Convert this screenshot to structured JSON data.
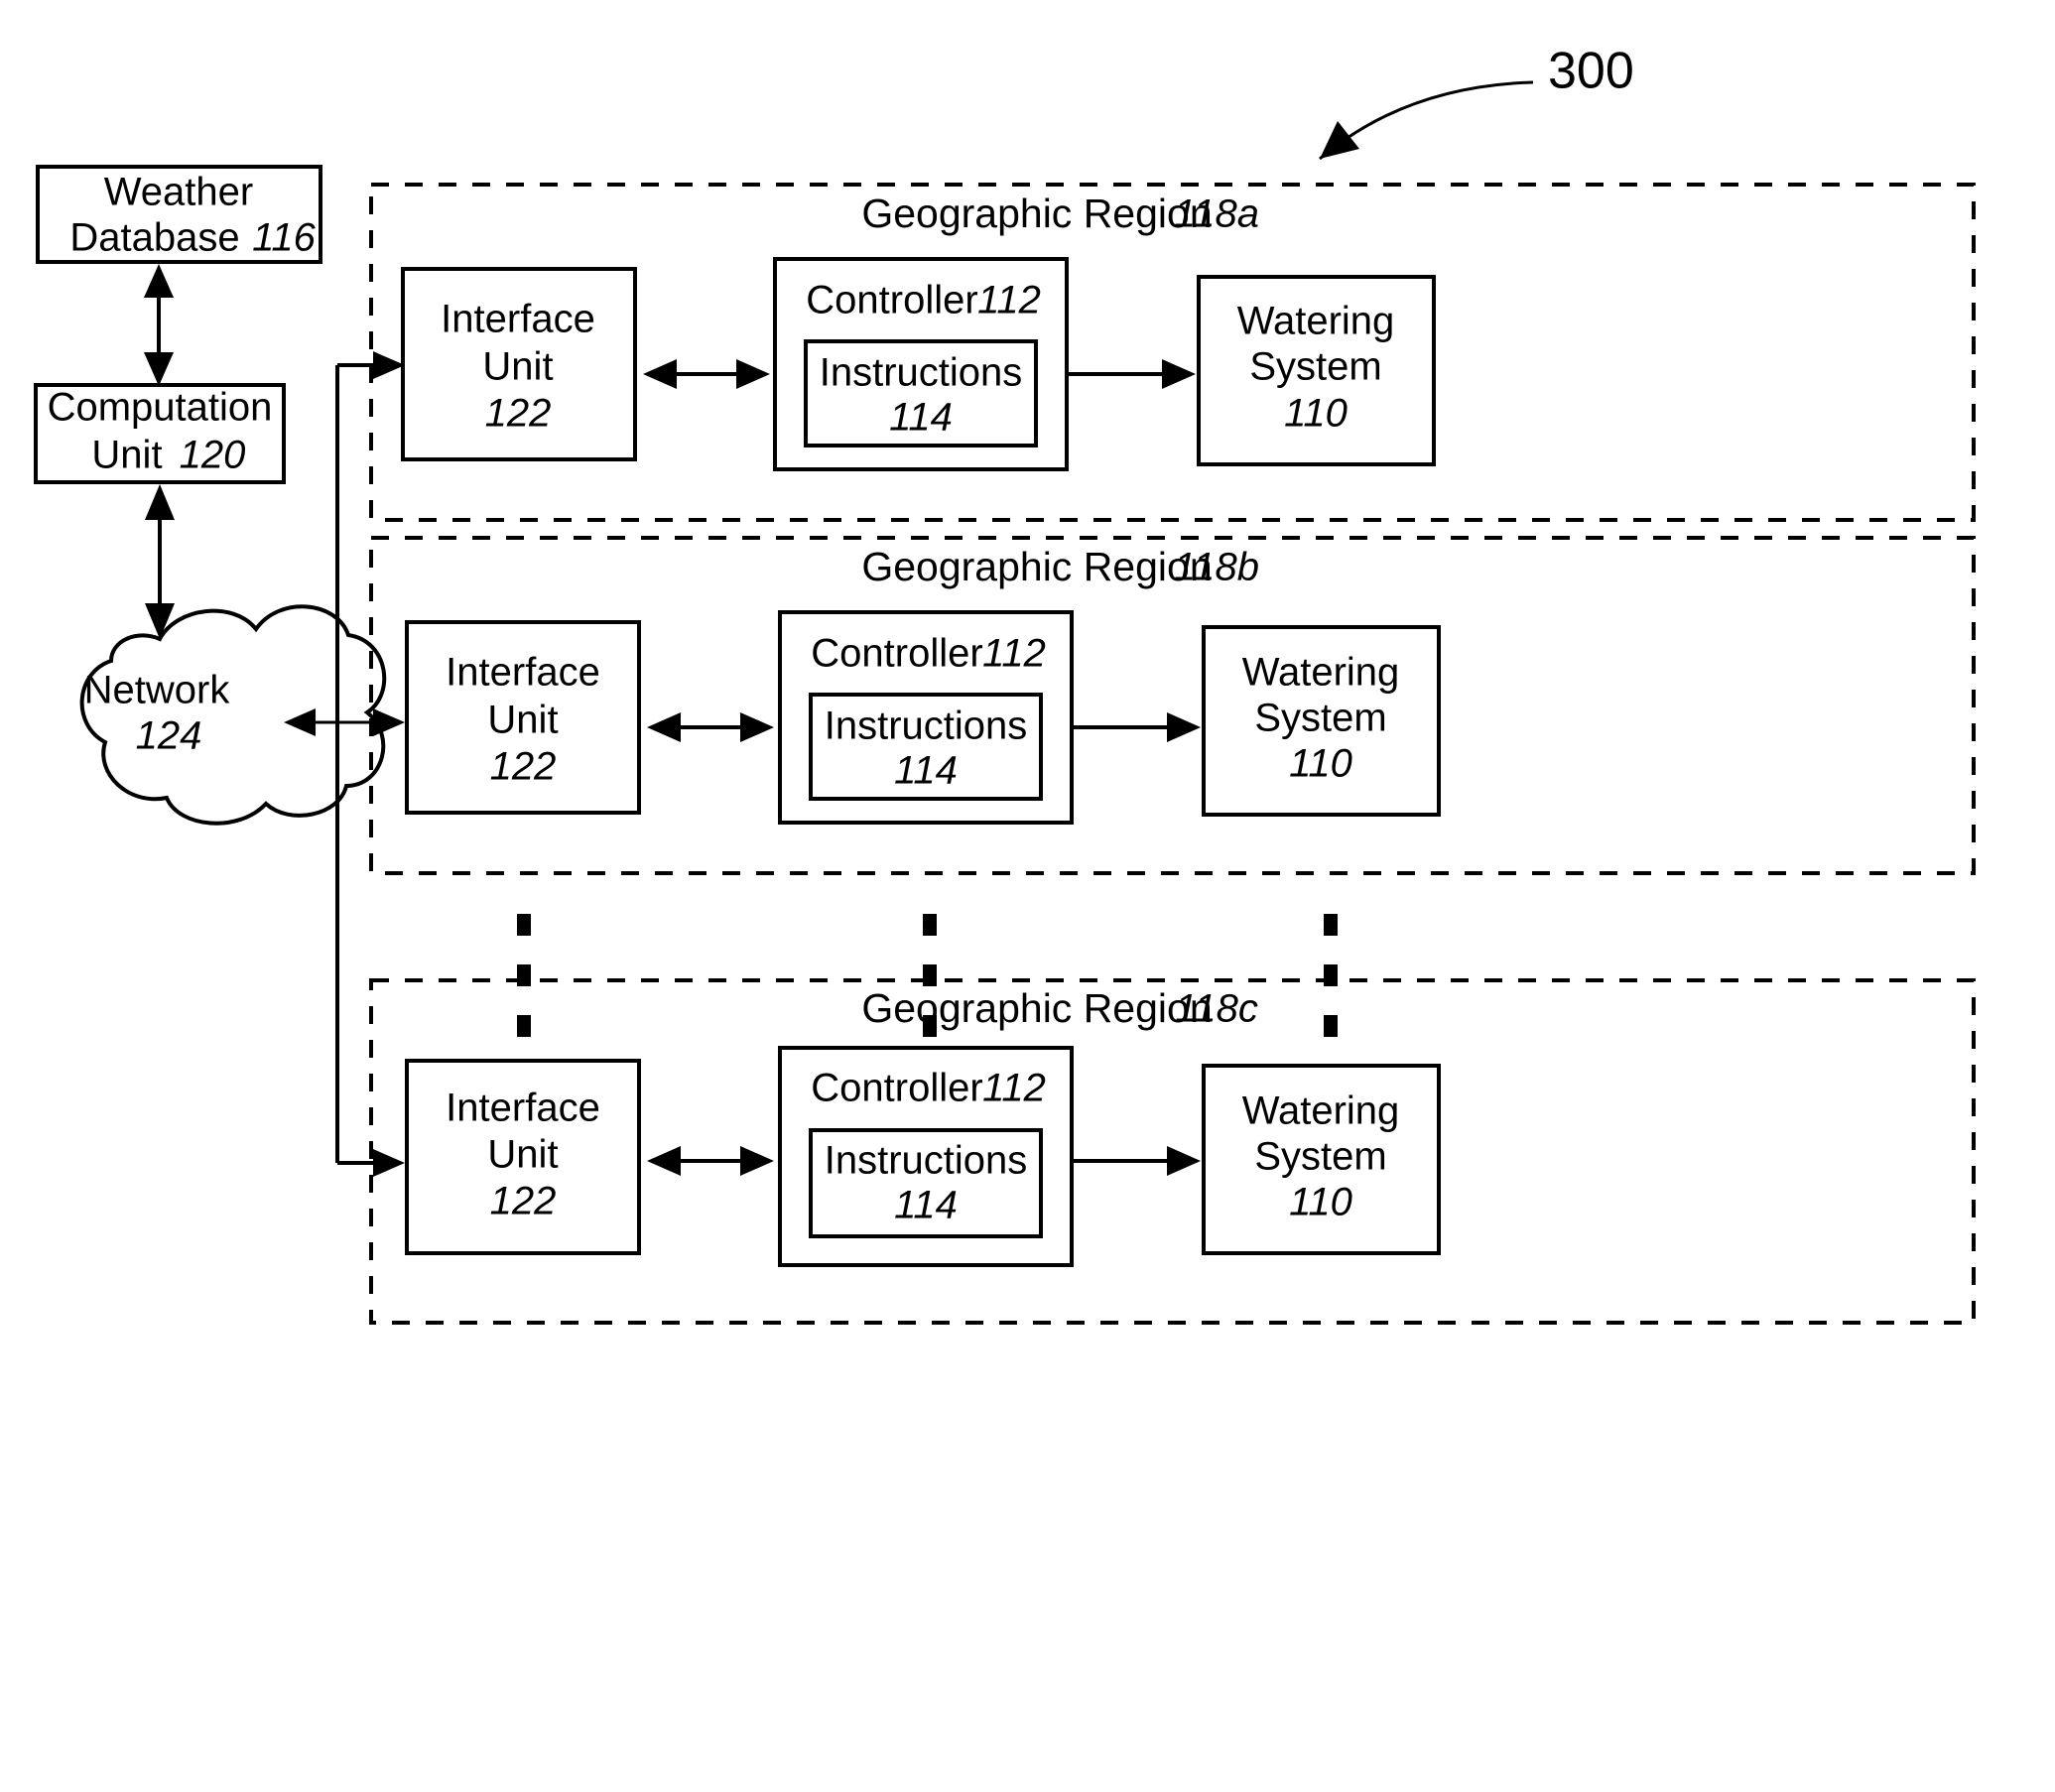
{
  "figure": {
    "number": "300",
    "callout_name": "figure-callout-300"
  },
  "left_column": {
    "weather_database": {
      "line1": "Weather",
      "line2": "Database",
      "ref": "116"
    },
    "computation_unit": {
      "line1": "Computation",
      "line2": "Unit",
      "ref": "120"
    },
    "network": {
      "line1": "Network",
      "ref": "124"
    }
  },
  "regions": [
    {
      "id": "118a",
      "title": "Geographic Region",
      "ref": "118a",
      "interface_unit": {
        "line1": "Interface",
        "line2": "Unit",
        "ref": "122"
      },
      "controller": {
        "title": "Controller",
        "ref": "112"
      },
      "instructions": {
        "title": "Instructions",
        "ref": "114"
      },
      "watering_system": {
        "line1": "Watering",
        "line2": "System",
        "ref": "110"
      }
    },
    {
      "id": "118b",
      "title": "Geographic Region",
      "ref": "118b",
      "interface_unit": {
        "line1": "Interface",
        "line2": "Unit",
        "ref": "122"
      },
      "controller": {
        "title": "Controller",
        "ref": "112"
      },
      "instructions": {
        "title": "Instructions",
        "ref": "114"
      },
      "watering_system": {
        "line1": "Watering",
        "line2": "System",
        "ref": "110"
      }
    },
    {
      "id": "118c",
      "title": "Geographic Region",
      "ref": "118c",
      "interface_unit": {
        "line1": "Interface",
        "line2": "Unit",
        "ref": "122"
      },
      "controller": {
        "title": "Controller",
        "ref": "112"
      },
      "instructions": {
        "title": "Instructions",
        "ref": "114"
      },
      "watering_system": {
        "line1": "Watering",
        "line2": "System",
        "ref": "110"
      }
    }
  ],
  "ellipsis": {
    "label": "vertical-ellipsis",
    "count": 3
  },
  "colors": {
    "ink": "#000000",
    "paper": "#ffffff"
  }
}
